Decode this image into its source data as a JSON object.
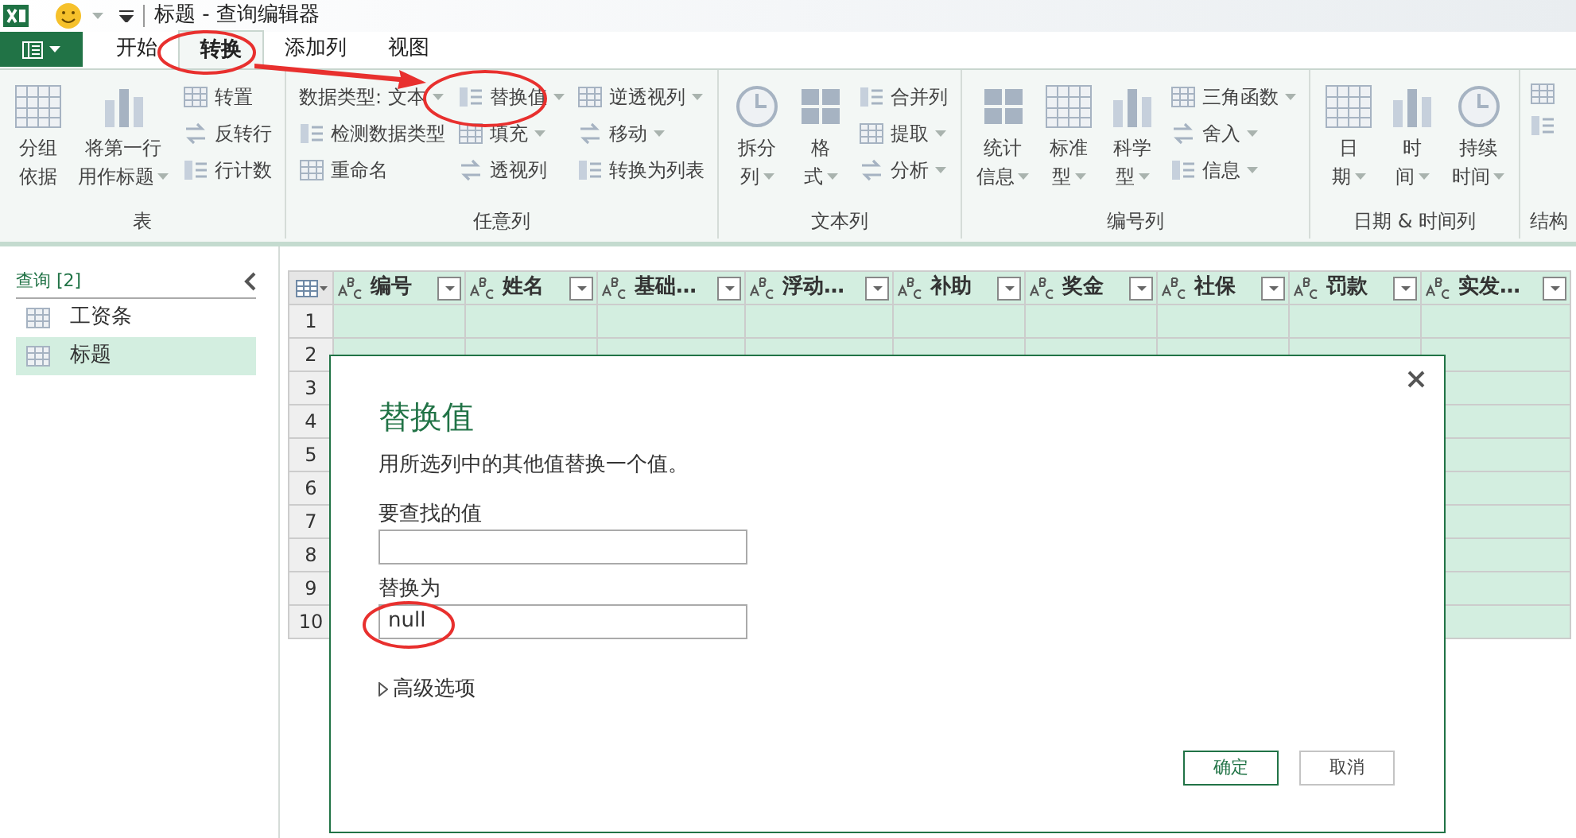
{
  "title_bar": {
    "title": "标题 - 查询编辑器"
  },
  "tabs": [
    {
      "label": "开始",
      "selected": false
    },
    {
      "label": "转换",
      "selected": true
    },
    {
      "label": "添加列",
      "selected": false
    },
    {
      "label": "视图",
      "selected": false
    }
  ],
  "ribbon": {
    "groups": [
      {
        "label": "表",
        "kind": "full",
        "big": [
          {
            "lines": [
              "分组",
              "依据"
            ],
            "dropdown": false
          },
          {
            "lines": [
              "将第一行",
              "用作标题"
            ],
            "dropdown": true
          }
        ],
        "small_columns": [
          [
            {
              "label": "转置",
              "kind": "icon",
              "dropdown": false
            },
            {
              "label": "反转行",
              "kind": "icon",
              "dropdown": false
            },
            {
              "label": "行计数",
              "kind": "icon",
              "dropdown": false
            }
          ]
        ]
      },
      {
        "label": "任意列",
        "kind": "full",
        "small_columns": [
          [
            {
              "label": "数据类型: 文本",
              "kind": "plain",
              "dropdown": true
            },
            {
              "label": "检测数据类型",
              "kind": "icon",
              "dropdown": false
            },
            {
              "label": "重命名",
              "kind": "icon",
              "dropdown": false
            }
          ],
          [
            {
              "label": "替换值",
              "kind": "icon",
              "dropdown": true
            },
            {
              "label": "填充",
              "kind": "icon",
              "dropdown": true
            },
            {
              "label": "透视列",
              "kind": "icon",
              "dropdown": false
            }
          ],
          [
            {
              "label": "逆透视列",
              "kind": "icon",
              "dropdown": true
            },
            {
              "label": "移动",
              "kind": "icon",
              "dropdown": true
            },
            {
              "label": "转换为列表",
              "kind": "icon",
              "dropdown": false
            }
          ]
        ]
      },
      {
        "label": "文本列",
        "kind": "full",
        "big": [
          {
            "lines": [
              "拆分",
              "列"
            ],
            "dropdown": true
          },
          {
            "lines": [
              "格",
              "式"
            ],
            "dropdown": true
          }
        ],
        "small_columns": [
          [
            {
              "label": "合并列",
              "kind": "icon",
              "dropdown": false
            },
            {
              "label": "提取",
              "kind": "icon",
              "dropdown": true
            },
            {
              "label": "分析",
              "kind": "icon",
              "dropdown": true
            }
          ]
        ]
      },
      {
        "label": "编号列",
        "kind": "full",
        "big": [
          {
            "lines": [
              "统计",
              "信息"
            ],
            "dropdown": true
          },
          {
            "lines": [
              "标准",
              "型"
            ],
            "dropdown": true
          },
          {
            "lines": [
              "科学",
              "型"
            ],
            "dropdown": true
          }
        ],
        "small_columns": [
          [
            {
              "label": "三角函数",
              "kind": "icon",
              "dropdown": true
            },
            {
              "label": "舍入",
              "kind": "icon",
              "dropdown": true
            },
            {
              "label": "信息",
              "kind": "icon",
              "dropdown": true
            }
          ]
        ]
      },
      {
        "label": "日期 & 时间列",
        "kind": "full",
        "big": [
          {
            "lines": [
              "日",
              "期"
            ],
            "dropdown": true
          },
          {
            "lines": [
              "时",
              "间"
            ],
            "dropdown": true
          },
          {
            "lines": [
              "持续",
              "时间"
            ],
            "dropdown": true
          }
        ]
      },
      {
        "label": "结构",
        "kind": "cut"
      }
    ]
  },
  "queries": {
    "header": "查询 [2]",
    "items": [
      {
        "label": "工资条",
        "selected": false
      },
      {
        "label": "标题",
        "selected": true
      }
    ]
  },
  "table": {
    "columns": [
      "编号",
      "姓名",
      "基础…",
      "浮动…",
      "补助",
      "奖金",
      "社保",
      "罚款",
      "实发…"
    ],
    "row_numbers": [
      "1",
      "2",
      "3",
      "4",
      "5",
      "6",
      "7",
      "8",
      "9",
      "10"
    ]
  },
  "dialog": {
    "title": "替换值",
    "description": "用所选列中的其他值替换一个值。",
    "fields": [
      {
        "label": "要查找的值"
      },
      {
        "label": "替换为",
        "value": "null"
      }
    ],
    "advanced": {
      "label": "高级选项",
      "expanded": false
    },
    "buttons": [
      {
        "label": "确定",
        "kind": "primary"
      },
      {
        "label": "取消",
        "kind": "secondary"
      }
    ]
  }
}
